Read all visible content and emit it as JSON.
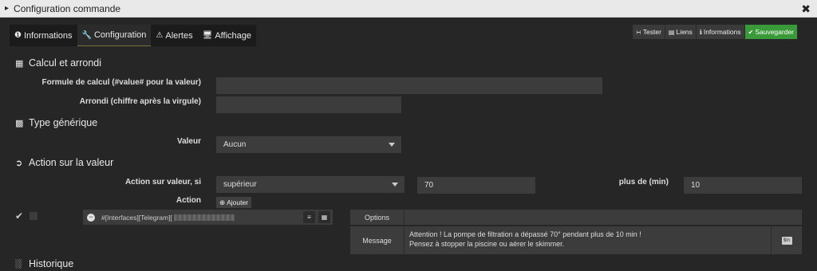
{
  "window": {
    "title": "Configuration commande"
  },
  "tabs": [
    {
      "label": "Informations",
      "icon": "info-circle-icon"
    },
    {
      "label": "Configuration",
      "icon": "wrench-icon"
    },
    {
      "label": "Alertes",
      "icon": "warning-icon"
    },
    {
      "label": "Affichage",
      "icon": "monitor-icon"
    }
  ],
  "toolbar": {
    "test": "Tester",
    "links": "Liens",
    "informations": "Informations",
    "save": "Sauvegarder",
    "save_color": "#3a9a3a"
  },
  "sections": {
    "calc": "Calcul et arrondi",
    "generic": "Type générique",
    "action": "Action sur la valeur",
    "history": "Historique"
  },
  "calc": {
    "formula_label": "Formule de calcul (#value# pour la valeur)",
    "formula_value": "",
    "round_label": "Arrondi (chiffre après la virgule)",
    "round_value": ""
  },
  "generic": {
    "value_label": "Valeur",
    "value_selected": "Aucun"
  },
  "action": {
    "condition_label": "Action sur valeur, si",
    "condition_selected": "supérieur",
    "threshold_value": "70",
    "duration_label": "plus de (min)",
    "duration_value": "10",
    "action_label": "Action",
    "add_button": "Ajouter",
    "command_text": "#[Interfaces][Telegram][",
    "options_label": "Options",
    "message_label": "Message",
    "message_line1": "Attention ! La pompe de filtration a dépassé 70° pendant plus de 10 min !",
    "message_line2": "Pensez à stopper la piscine ou aérer le skimmer."
  }
}
